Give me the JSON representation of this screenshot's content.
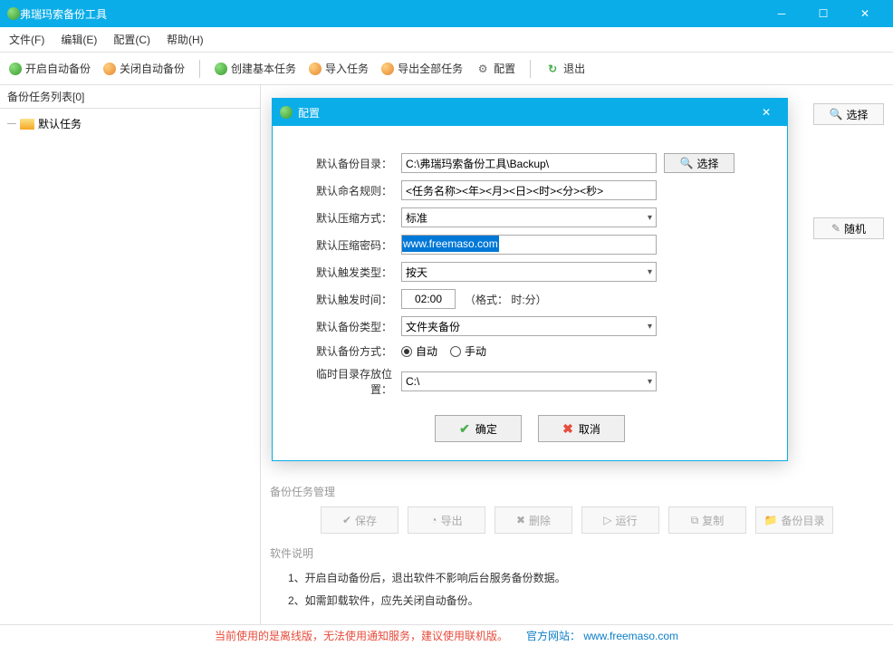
{
  "app": {
    "title": "弗瑞玛索备份工具"
  },
  "menu": {
    "file": "文件(F)",
    "edit": "编辑(E)",
    "config": "配置(C)",
    "help": "帮助(H)"
  },
  "toolbar": {
    "start_auto": "开启自动备份",
    "stop_auto": "关闭自动备份",
    "create_task": "创建基本任务",
    "import_task": "导入任务",
    "export_all": "导出全部任务",
    "config": "配置",
    "exit": "退出"
  },
  "sidebar": {
    "header": "备份任务列表[0]",
    "root_item": "默认任务"
  },
  "side_buttons": {
    "choose": "选择",
    "random": "随机"
  },
  "task_mgmt": {
    "header": "备份任务管理",
    "save": "保存",
    "export": "导出",
    "delete": "删除",
    "run": "运行",
    "copy": "复制",
    "backup_dir": "备份目录"
  },
  "desc": {
    "header": "软件说明",
    "line1": "1、开启自动备份后，退出软件不影响后台服务备份数据。",
    "line2": "2、如需卸载软件，应先关闭自动备份。"
  },
  "status": {
    "warn": "当前使用的是离线版，无法使用通知服务，建议使用联机版。",
    "site_label": "官方网站：",
    "site_url": "www.freemaso.com"
  },
  "dialog": {
    "title": "配置",
    "labels": {
      "backup_dir": "默认备份目录：",
      "naming_rule": "默认命名规则：",
      "compress_mode": "默认压缩方式：",
      "compress_pwd": "默认压缩密码：",
      "trigger_type": "默认触发类型：",
      "trigger_time": "默认触发时间：",
      "backup_type": "默认备份类型：",
      "backup_mode": "默认备份方式：",
      "temp_dir": "临时目录存放位置："
    },
    "values": {
      "backup_dir": "C:\\弗瑞玛索备份工具\\Backup\\",
      "naming_rule": "<任务名称><年><月><日><时><分><秒>",
      "compress_mode": "标准",
      "compress_pwd": "www.freemaso.com",
      "trigger_type": "按天",
      "trigger_time": "02:00",
      "trigger_time_hint": "（格式：   时:分）",
      "backup_type": "文件夹备份",
      "backup_mode_auto": "自动",
      "backup_mode_manual": "手动",
      "temp_dir": "C:\\"
    },
    "choose_btn": "选择",
    "ok": "确定",
    "cancel": "取消"
  }
}
